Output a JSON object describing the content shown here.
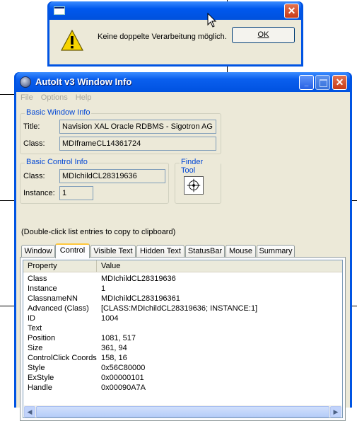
{
  "message_box": {
    "message": "Keine doppelte Verarbeitung möglich.",
    "ok_label": "OK",
    "close_glyph": "✕",
    "icon": "warning-icon"
  },
  "autoit": {
    "title": "AutoIt v3 Window Info",
    "titlebar": {
      "minimize_glyph": "_",
      "close_glyph": "✕"
    },
    "menu": [
      "File",
      "Options",
      "Help"
    ],
    "basic_window": {
      "label": "Basic Window Info",
      "title_label": "Title:",
      "title_value": "Navision XAL Oracle RDBMS - Sigotron AG",
      "class_label": "Class:",
      "class_value": "MDIframeCL14361724"
    },
    "basic_control": {
      "label": "Basic Control Info",
      "class_label": "Class:",
      "class_value": "MDIchildCL28319636",
      "instance_label": "Instance:",
      "instance_value": "1"
    },
    "finder_tool": {
      "label": "Finder Tool",
      "icon": "crosshair-icon"
    },
    "hint": "(Double-click list entries to copy to clipboard)",
    "tabs": [
      "Window",
      "Control",
      "Visible Text",
      "Hidden Text",
      "StatusBar",
      "Mouse",
      "Summary"
    ],
    "active_tab": "Control",
    "list": {
      "col_property": "Property",
      "col_value": "Value",
      "rows": [
        {
          "property": "Class",
          "value": "MDIchildCL28319636"
        },
        {
          "property": "Instance",
          "value": "1"
        },
        {
          "property": "ClassnameNN",
          "value": "MDIchildCL283196361"
        },
        {
          "property": "Advanced (Class)",
          "value": "[CLASS:MDIchildCL28319636; INSTANCE:1]"
        },
        {
          "property": "ID",
          "value": "1004"
        },
        {
          "property": "Text",
          "value": ""
        },
        {
          "property": "Position",
          "value": "1081, 517"
        },
        {
          "property": "Size",
          "value": "361, 94"
        },
        {
          "property": "ControlClick Coords",
          "value": "158, 16"
        },
        {
          "property": "Style",
          "value": "0x56C80000"
        },
        {
          "property": "ExStyle",
          "value": "0x00000101"
        },
        {
          "property": "Handle",
          "value": "0x00090A7A"
        }
      ]
    },
    "scrollbar": {
      "left_glyph": "◀",
      "right_glyph": "▶"
    }
  }
}
